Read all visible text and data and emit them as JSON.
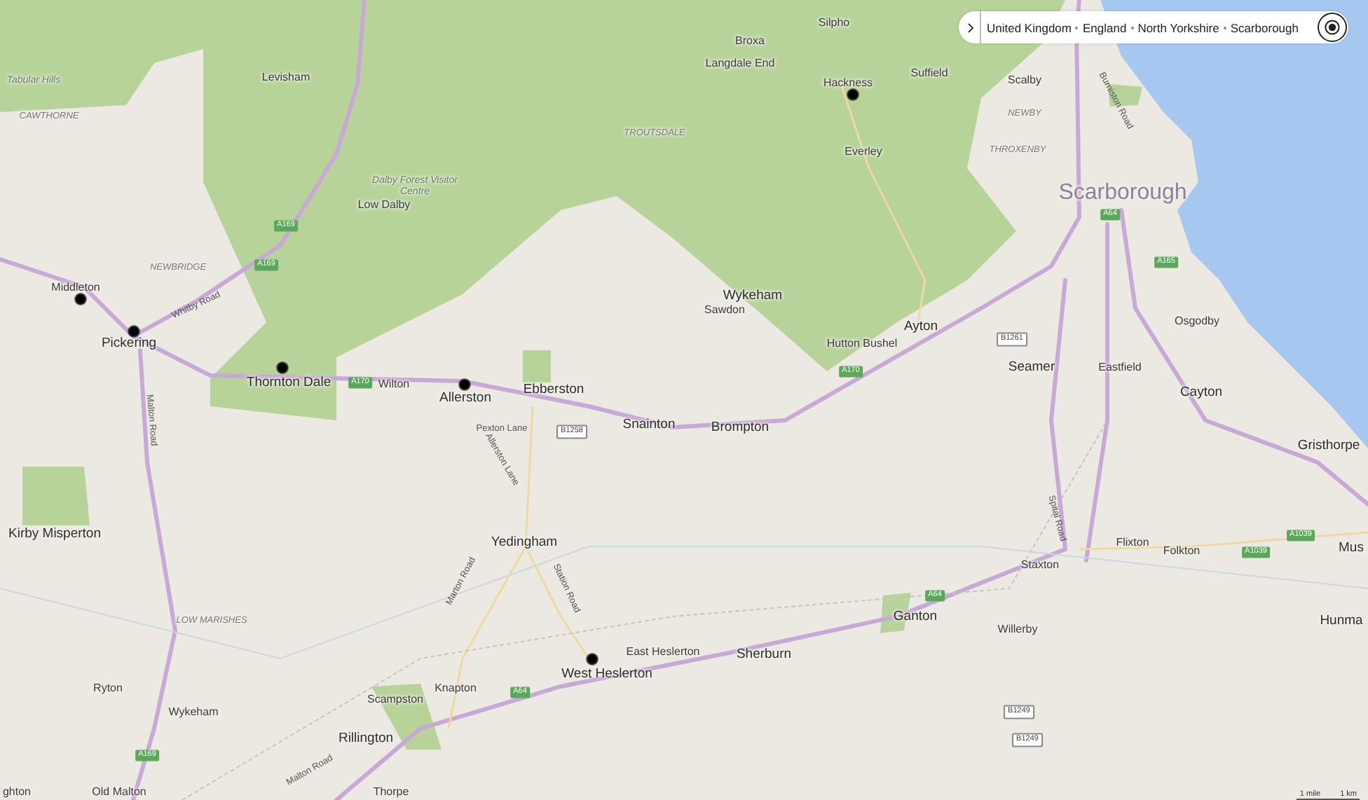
{
  "breadcrumb": {
    "items": [
      "United Kingdom",
      "England",
      "North Yorkshire",
      "Scarborough"
    ]
  },
  "places": [
    {
      "name": "Tabular Hills",
      "kind": "feature",
      "pinned": false
    },
    {
      "name": "CAWTHORNE",
      "kind": "locality",
      "pinned": false
    },
    {
      "name": "Levisham",
      "kind": "village",
      "pinned": false
    },
    {
      "name": "TROUTSDALE",
      "kind": "locality",
      "pinned": false
    },
    {
      "name": "Silpho",
      "kind": "village",
      "pinned": false
    },
    {
      "name": "Broxa",
      "kind": "village",
      "pinned": false
    },
    {
      "name": "Langdale End",
      "kind": "village",
      "pinned": false
    },
    {
      "name": "Hackness",
      "kind": "village",
      "pinned": true
    },
    {
      "name": "Suffield",
      "kind": "village",
      "pinned": false
    },
    {
      "name": "Scalby",
      "kind": "village",
      "pinned": false
    },
    {
      "name": "NEWBY",
      "kind": "locality",
      "pinned": false
    },
    {
      "name": "Everley",
      "kind": "village",
      "pinned": false
    },
    {
      "name": "THROXENBY",
      "kind": "locality",
      "pinned": false
    },
    {
      "name": "Dalby Forest Visitor Centre",
      "kind": "feature",
      "pinned": false
    },
    {
      "name": "Low Dalby",
      "kind": "village",
      "pinned": false
    },
    {
      "name": "Scarborough",
      "kind": "city",
      "pinned": false
    },
    {
      "name": "NEWBRIDGE",
      "kind": "locality",
      "pinned": false
    },
    {
      "name": "Middleton",
      "kind": "village",
      "pinned": true
    },
    {
      "name": "Pickering",
      "kind": "town",
      "pinned": true
    },
    {
      "name": "Thornton Dale",
      "kind": "town",
      "pinned": true
    },
    {
      "name": "Wilton",
      "kind": "village",
      "pinned": false
    },
    {
      "name": "Allerston",
      "kind": "town",
      "pinned": true
    },
    {
      "name": "Ebberston",
      "kind": "town",
      "pinned": false
    },
    {
      "name": "Wykeham",
      "kind": "town",
      "pinned": false
    },
    {
      "name": "Sawdon",
      "kind": "village",
      "pinned": false
    },
    {
      "name": "Hutton Bushel",
      "kind": "village",
      "pinned": false
    },
    {
      "name": "Ayton",
      "kind": "town",
      "pinned": false
    },
    {
      "name": "Osgodby",
      "kind": "village",
      "pinned": false
    },
    {
      "name": "Seamer",
      "kind": "town",
      "pinned": false
    },
    {
      "name": "Eastfield",
      "kind": "village",
      "pinned": false
    },
    {
      "name": "Cayton",
      "kind": "town",
      "pinned": false
    },
    {
      "name": "Snainton",
      "kind": "town",
      "pinned": false
    },
    {
      "name": "Brompton",
      "kind": "town",
      "pinned": false
    },
    {
      "name": "Gristhorpe",
      "kind": "town",
      "pinned": false
    },
    {
      "name": "Kirby Misperton",
      "kind": "town",
      "pinned": false
    },
    {
      "name": "Yedingham",
      "kind": "town",
      "pinned": false
    },
    {
      "name": "Flixton",
      "kind": "village",
      "pinned": false
    },
    {
      "name": "Folkton",
      "kind": "village",
      "pinned": false
    },
    {
      "name": "Staxton",
      "kind": "village",
      "pinned": false
    },
    {
      "name": "Mus",
      "kind": "town",
      "pinned": false
    },
    {
      "name": "LOW MARISHES",
      "kind": "locality",
      "pinned": false
    },
    {
      "name": "Ganton",
      "kind": "town",
      "pinned": false
    },
    {
      "name": "Hunma",
      "kind": "town",
      "pinned": false
    },
    {
      "name": "Willerby",
      "kind": "village",
      "pinned": false
    },
    {
      "name": "East Heslerton",
      "kind": "village",
      "pinned": false
    },
    {
      "name": "Sherburn",
      "kind": "town",
      "pinned": false
    },
    {
      "name": "West Heslerton",
      "kind": "town",
      "pinned": true
    },
    {
      "name": "Ryton",
      "kind": "village",
      "pinned": false
    },
    {
      "name": "Knapton",
      "kind": "village",
      "pinned": false
    },
    {
      "name": "Scampston",
      "kind": "village",
      "pinned": false
    },
    {
      "name": "Wykeham",
      "kind": "village",
      "pinned": false
    },
    {
      "name": "Rillington",
      "kind": "town",
      "pinned": false
    },
    {
      "name": "ghton",
      "kind": "village",
      "pinned": false
    },
    {
      "name": "Old Malton",
      "kind": "village",
      "pinned": false
    },
    {
      "name": "Thorpe",
      "kind": "village",
      "pinned": false
    }
  ],
  "road_labels": [
    "Whitby Road",
    "Malton Road",
    "Pexton Lane",
    "Allerston Lane",
    "Marton Road",
    "Station Road",
    "Burniston Road",
    "Spital Road",
    "Malton Road"
  ],
  "road_shields": [
    {
      "number": "A169",
      "kind": "primary"
    },
    {
      "number": "A169",
      "kind": "primary"
    },
    {
      "number": "A170",
      "kind": "primary"
    },
    {
      "number": "A170",
      "kind": "primary"
    },
    {
      "number": "A64",
      "kind": "primary"
    },
    {
      "number": "A165",
      "kind": "primary"
    },
    {
      "number": "B1261",
      "kind": "minor"
    },
    {
      "number": "B1258",
      "kind": "minor"
    },
    {
      "number": "A64",
      "kind": "primary"
    },
    {
      "number": "A64",
      "kind": "primary"
    },
    {
      "number": "A1039",
      "kind": "primary"
    },
    {
      "number": "A1039",
      "kind": "primary"
    },
    {
      "number": "B1249",
      "kind": "minor"
    },
    {
      "number": "B1249",
      "kind": "minor"
    },
    {
      "number": "A169",
      "kind": "primary"
    }
  ],
  "scale": {
    "miles": "1 mile",
    "km": "1 km"
  }
}
